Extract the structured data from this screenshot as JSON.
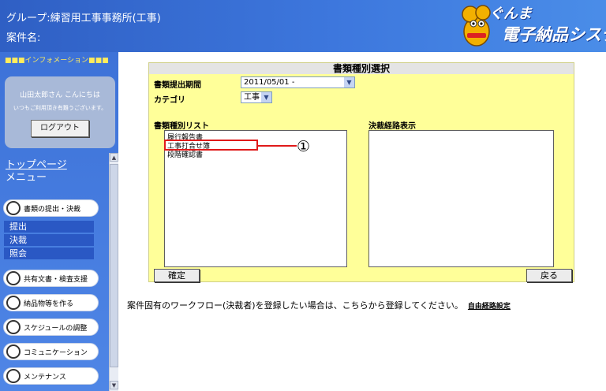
{
  "header": {
    "group_label": "グループ:練習用工事事務所(工事)",
    "case_label": "案件名:",
    "logo": {
      "title_line1": "ぐんま",
      "title_line2": "電子納品システム"
    }
  },
  "sidebar": {
    "info_bar": "■■■インフォメーション■■■",
    "user_greeting": "山田太郎さん こんにちは",
    "thanks_message": "いつもご利用頂き有難うございます。",
    "logout_label": "ログアウト",
    "top_page_link": "トップページ",
    "menu_title": "メニュー",
    "menu_groups": [
      {
        "label": "書類の提出・決裁",
        "icon": "document-icon"
      },
      {
        "label": "共有文書・検査支援",
        "icon": "document-icon"
      },
      {
        "label": "納品物等を作る",
        "icon": "folder-icon"
      },
      {
        "label": "スケジュールの調整",
        "icon": "calendar-icon"
      },
      {
        "label": "コミュニケーション",
        "icon": "mail-icon"
      },
      {
        "label": "メンテナンス",
        "icon": "wrench-icon"
      }
    ],
    "submenu": [
      "提出",
      "決裁",
      "照会"
    ]
  },
  "panel": {
    "title": "書類種別選択",
    "period_label": "書類提出期間",
    "period_value": "2011/05/01 -",
    "category_label": "カテゴリ",
    "category_value": "工事",
    "doc_list_label": "書類種別リスト",
    "doc_list_items": [
      "履行報告書",
      "工事打合せ簿",
      "段階確認書"
    ],
    "approval_route_label": "決裁経路表示",
    "callout_number": "①",
    "confirm_button": "確定",
    "back_button": "戻る"
  },
  "footer": {
    "message": "案件固有のワークフロー(決裁者)を登録したい場合は、こちらから登録してください。",
    "link_label": "自由経路設定"
  },
  "colors": {
    "header_blue": "#3d77dd",
    "panel_yellow": "#ffff99",
    "highlight_red": "#e01a1a"
  }
}
